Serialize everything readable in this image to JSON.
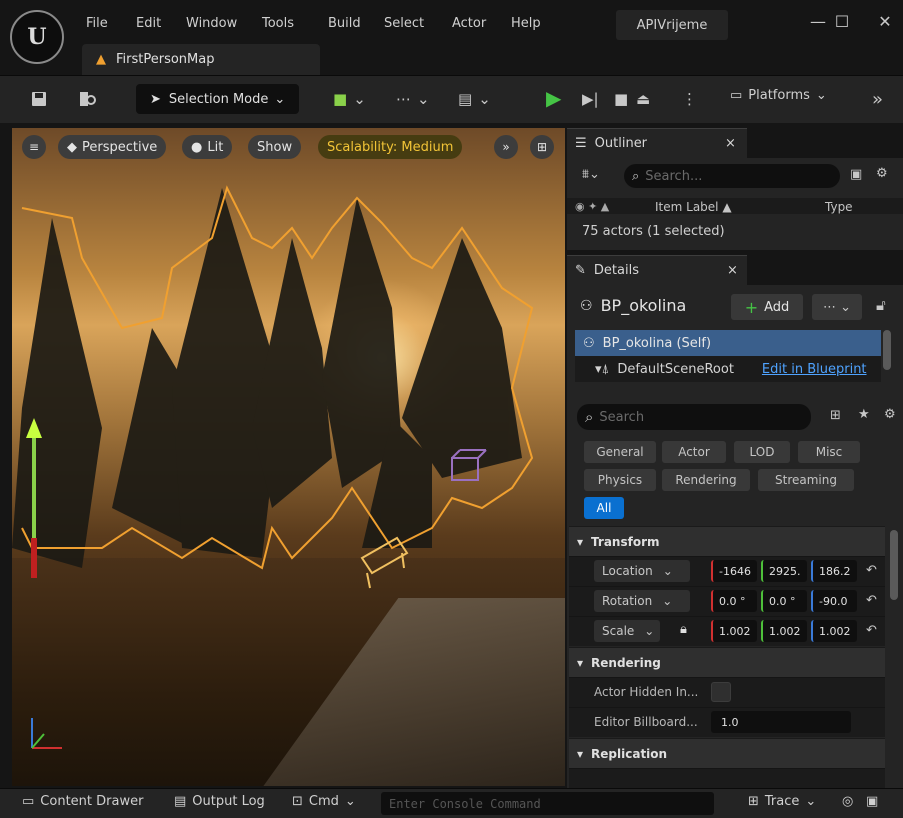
{
  "titlebar": {
    "menu": [
      "File",
      "Edit",
      "Window",
      "Tools",
      "Build",
      "Select",
      "Actor",
      "Help"
    ],
    "project_name": "APIVrijeme",
    "document_tab": "FirstPersonMap"
  },
  "toolbar": {
    "selection_mode": "Selection Mode",
    "platforms": "Platforms"
  },
  "viewport": {
    "perspective": "Perspective",
    "lit": "Lit",
    "show": "Show",
    "scalability": "Scalability: Medium"
  },
  "outliner": {
    "tab_label": "Outliner",
    "search_placeholder": "Search...",
    "col_item_label": "Item Label ▲",
    "col_type": "Type",
    "status": "75 actors (1 selected)"
  },
  "details": {
    "tab_label": "Details",
    "actor_name": "BP_okolina",
    "add_button": "Add",
    "components": [
      {
        "label": "BP_okolina (Self)"
      },
      {
        "label": "DefaultSceneRoot",
        "action": "Edit in Blueprint"
      }
    ],
    "search_placeholder": "Search",
    "filters_row1": [
      "General",
      "Actor",
      "LOD",
      "Misc"
    ],
    "filters_row2": [
      "Physics",
      "Rendering",
      "Streaming"
    ],
    "filter_all": "All",
    "transform_section": "Transform",
    "location_label": "Location",
    "location": [
      "-1646",
      "2925.",
      "186.2"
    ],
    "rotation_label": "Rotation",
    "rotation": [
      "0.0 °",
      "0.0 °",
      "-90.0"
    ],
    "scale_label": "Scale",
    "scale": [
      "1.002",
      "1.002",
      "1.002"
    ],
    "rendering_section": "Rendering",
    "actor_hidden_label": "Actor Hidden In...",
    "editor_billboard_label": "Editor Billboard...",
    "editor_billboard_value": "1.0",
    "replication_section": "Replication"
  },
  "bottombar": {
    "content_drawer": "Content Drawer",
    "output_log": "Output Log",
    "cmd": "Cmd",
    "console_placeholder": "Enter Console Command",
    "trace": "Trace"
  },
  "colors": {
    "accent_blue": "#0a70d0",
    "play_green": "#45c445",
    "scalability_yellow": "#f2c437",
    "selection_outline": "#f0a030"
  }
}
